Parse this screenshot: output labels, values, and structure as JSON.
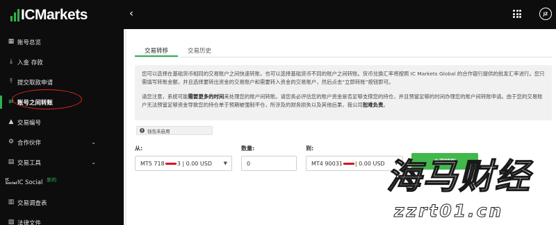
{
  "brand": {
    "logo_text": "ICMarkets"
  },
  "sidebar": {
    "items": [
      {
        "label": "账号总览",
        "icon": "dashboard-icon"
      },
      {
        "label": "入金 存款",
        "icon": "deposit-icon"
      },
      {
        "label": "提交取款申请",
        "icon": "withdraw-icon"
      },
      {
        "label": "账号之间转账",
        "icon": "transfer-icon",
        "active": true
      },
      {
        "label": "交易编号",
        "icon": "chart-icon"
      },
      {
        "label": "合作伙伴",
        "icon": "partner-icon",
        "expandable": true
      },
      {
        "label": "交易工具",
        "icon": "tools-icon",
        "expandable": true
      },
      {
        "label": "IC Social",
        "icon": "ic-social-icon",
        "badge": "新的"
      },
      {
        "label": "交易调查表",
        "icon": "survey-icon"
      },
      {
        "label": "法律文件",
        "icon": "document-icon"
      }
    ]
  },
  "topbar": {
    "avatar_initials": "JZ"
  },
  "tabs": [
    {
      "label": "交易转移",
      "active": true
    },
    {
      "label": "交易历史",
      "active": false
    }
  ],
  "notice": {
    "paragraph1": "您可以选择在基础货币相同的交易账户之间快速转账，也可以选择基础货币不同的账户之间转账。货币兑换汇率将按照 IC Markets Global 的合作银行提供的批发汇率进行。您只需填写转账金额，并且选择要转出资金的交易账户和需要转入资金的交易账户，然后点击“立即转账”按钮即可。",
    "paragraph2_pre": "请您注意，系统可能",
    "paragraph2_bold1": "需要更多的时间",
    "paragraph2_mid": "来处理您的账户间转账。请您务必评估您的账户资金是否足够支撑您的持仓，并且预留足够的时间办理您的账户间转账申请。由于您的交易账户无法预留足够资金导致您的持仓单于预期被强制平仓，所涉及的财务损失以及其他后果，我公司",
    "paragraph2_bold2": "恕难负责",
    "paragraph2_end": "。"
  },
  "wallet_badge": "钱包未启用",
  "form": {
    "from_label": "从:",
    "from_account_prefix": "MT5 718",
    "from_account_suffix": "3 | 0.00 USD",
    "amount_label": "数量:",
    "amount_value": "0",
    "to_label": "到:",
    "to_account_prefix": "MT4 90031",
    "to_account_suffix": " | 0.00 USD",
    "submit_label": "立即转账"
  },
  "watermark": {
    "line1": "海马财经",
    "line2": "zzrt01.cn"
  },
  "colors": {
    "accent": "#2fb24a",
    "sidebar_bg": "#0d0d0d",
    "highlight_circle": "#e52620",
    "redaction": "#d8101d"
  }
}
